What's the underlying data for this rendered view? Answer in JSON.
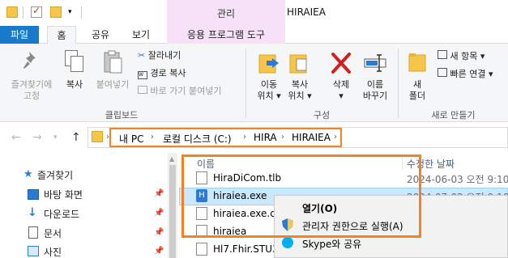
{
  "window": {
    "title": "HIRAIEA",
    "context_tab_label": "관리"
  },
  "tabs": {
    "file": "파일",
    "home": "홈",
    "share": "공유",
    "view": "보기",
    "app_tools": "응용 프로그램 도구"
  },
  "ribbon": {
    "clipboard": {
      "pin_line1": "즐겨찾기에",
      "pin_line2": "고정",
      "copy": "복사",
      "paste": "붙여넣기",
      "cut": "잘라내기",
      "copy_path": "경로 복사",
      "paste_shortcut": "바로 가기 붙여넣기",
      "group_label": "클립보드"
    },
    "organize": {
      "move_to_line1": "이동",
      "move_to_line2": "위치 ▾",
      "copy_to_line1": "복사",
      "copy_to_line2": "위치 ▾",
      "delete_line1": "삭제",
      "delete_line2": "▾",
      "rename_line1": "이름",
      "rename_line2": "바꾸기",
      "group_label": "구성"
    },
    "new": {
      "new_folder_line1": "새",
      "new_folder_line2": "폴더",
      "new_item": "새 항목 ▾",
      "easy_access": "빠른 연결 ▾",
      "group_label": "새로 만들기"
    }
  },
  "address": {
    "crumbs": [
      "내 PC",
      "로컬 디스크 (C:)",
      "HIRA",
      "HIRAIEA"
    ]
  },
  "nav_pane": {
    "items": [
      "즐겨찾기",
      "바탕 화면",
      "다운로드",
      "문서",
      "사진"
    ]
  },
  "columns": {
    "name": "이름",
    "date": "수정한 날짜"
  },
  "files": [
    {
      "name": "HiraDiCom.tlb",
      "date": "2024-06-03 오전 9:10"
    },
    {
      "name": "hiraiea.exe",
      "date": "2024-07-02 오전 9:10"
    },
    {
      "name": "hiraiea.exe.co",
      "date": ""
    },
    {
      "name": "hiraiea",
      "date": ""
    },
    {
      "name": "Hl7.Fhir.STU3.",
      "date": ""
    }
  ],
  "context_menu": {
    "open": "열기(O)",
    "run_as_admin": "관리자 권한으로 실행(A)",
    "skype_share": "Skype와 공유"
  },
  "colors": {
    "accent": "#1979ca",
    "highlight_orange": "#f58220",
    "context_tab": "#f6e1f8",
    "selection": "#cce8ff"
  }
}
